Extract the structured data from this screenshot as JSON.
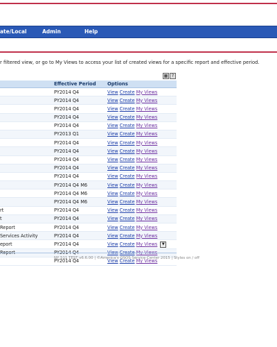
{
  "nav": {
    "items": [
      "ate/Local",
      "Admin",
      "Help"
    ]
  },
  "instruction": "r filtered view, or go to My Views to access your list of created views for a specific report and effective period.",
  "table": {
    "headers": {
      "period": "Effective Period",
      "options": "Options"
    },
    "option_labels": [
      "View",
      "Create",
      "My Views"
    ],
    "rows": [
      {
        "name": "",
        "period": "PY2014 Q4"
      },
      {
        "name": "",
        "period": "PY2014 Q4"
      },
      {
        "name": "",
        "period": "PY2014 Q4"
      },
      {
        "name": "",
        "period": "PY2014 Q4"
      },
      {
        "name": "",
        "period": "PY2014 Q4"
      },
      {
        "name": "",
        "period": "PY2013 Q1"
      },
      {
        "name": "",
        "period": "PY2014 Q4"
      },
      {
        "name": "",
        "period": "PY2014 Q4"
      },
      {
        "name": "",
        "period": "PY2014 Q4"
      },
      {
        "name": "",
        "period": "PY2014 Q4"
      },
      {
        "name": "",
        "period": "PY2014 Q4"
      },
      {
        "name": "",
        "period": "PY2014 Q4 M6"
      },
      {
        "name": "",
        "period": "PY2014 Q4 M6"
      },
      {
        "name": "",
        "period": "PY2014 Q4 M6"
      },
      {
        "name": "rt",
        "period": "PY2014 Q4"
      },
      {
        "name": "t",
        "period": "PY2014 Q4"
      },
      {
        "name": "Report",
        "period": "PY2014 Q4"
      },
      {
        "name": "Services Activity",
        "period": "PY2014 Q4"
      },
      {
        "name": "eport",
        "period": "PY2014 Q4"
      },
      {
        "name": "Report",
        "period": "PY2014 Q4"
      },
      {
        "name": "",
        "period": "PY2014 Q4"
      }
    ]
  },
  "footer": {
    "text": "NY 511 TEST v6.6.00 | ©America's OSOS Service Center 2015 | Styles ",
    "on": "on",
    "sep": " / ",
    "off": "off"
  },
  "colors": {
    "accent_red": "#c0304a",
    "nav_blue": "#2a59b6",
    "link_blue": "#1a3ca8",
    "visited_purple": "#6b2fa0"
  },
  "icons": [
    "export-icon",
    "help-icon",
    "expand-more-icon"
  ]
}
